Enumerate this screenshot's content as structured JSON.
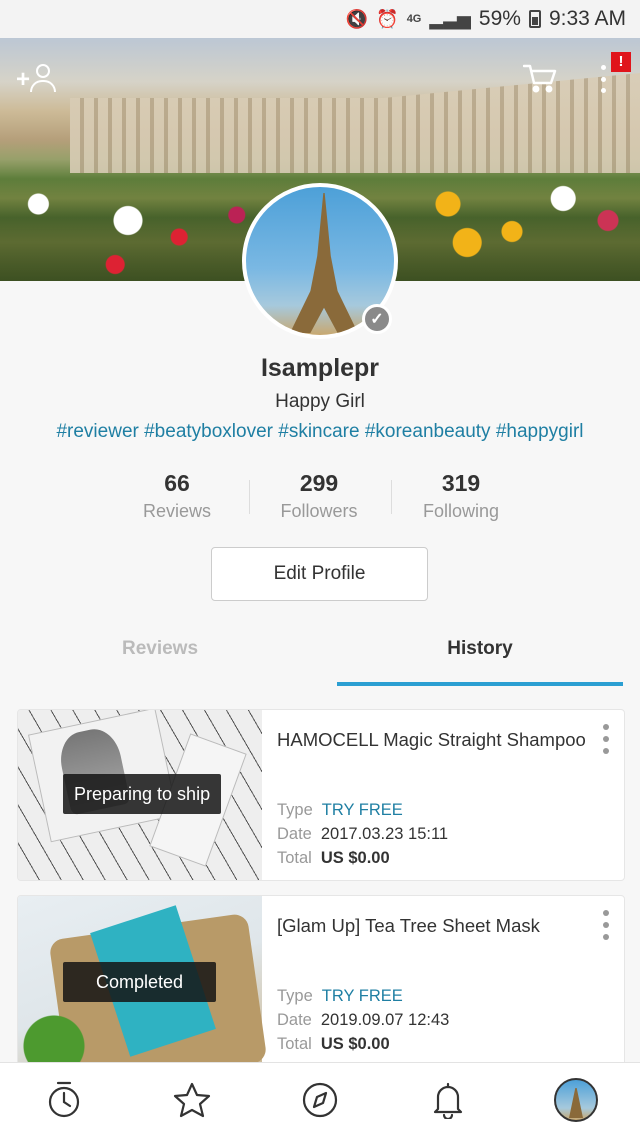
{
  "status_bar": {
    "battery": "59%",
    "time": "9:33 AM",
    "network": "4G"
  },
  "header": {
    "alert_badge": "!",
    "icons": [
      "add-friend-icon",
      "cart-icon",
      "more-vertical-icon"
    ]
  },
  "profile": {
    "username": "Isamplepr",
    "bio": "Happy Girl",
    "hashtags": "#reviewer #beatyboxlover #skincare #koreanbeauty #happygirl",
    "stats": [
      {
        "value": "66",
        "label": "Reviews"
      },
      {
        "value": "299",
        "label": "Followers"
      },
      {
        "value": "319",
        "label": "Following"
      }
    ],
    "edit_button": "Edit Profile"
  },
  "tabs": {
    "reviews": "Reviews",
    "history": "History",
    "active": "History"
  },
  "history": {
    "field_labels": {
      "type": "Type",
      "date": "Date",
      "total": "Total"
    },
    "items": [
      {
        "status": "Preparing to ship",
        "title": "HAMOCELL Magic Straight Shampoo",
        "type": "TRY FREE",
        "date": "2017.03.23 15:11",
        "total": "US $0.00"
      },
      {
        "status": "Completed",
        "title": "[Glam Up] Tea Tree Sheet Mask",
        "type": "TRY FREE",
        "date": "2019.09.07 12:43",
        "total": "US $0.00"
      }
    ]
  },
  "bottom_nav": {
    "items": [
      "timer-icon",
      "star-icon",
      "compass-icon",
      "bell-icon",
      "profile-avatar"
    ]
  },
  "colors": {
    "accent": "#2b9fd2",
    "link": "#1f7fa3",
    "alert": "#e0141b"
  }
}
